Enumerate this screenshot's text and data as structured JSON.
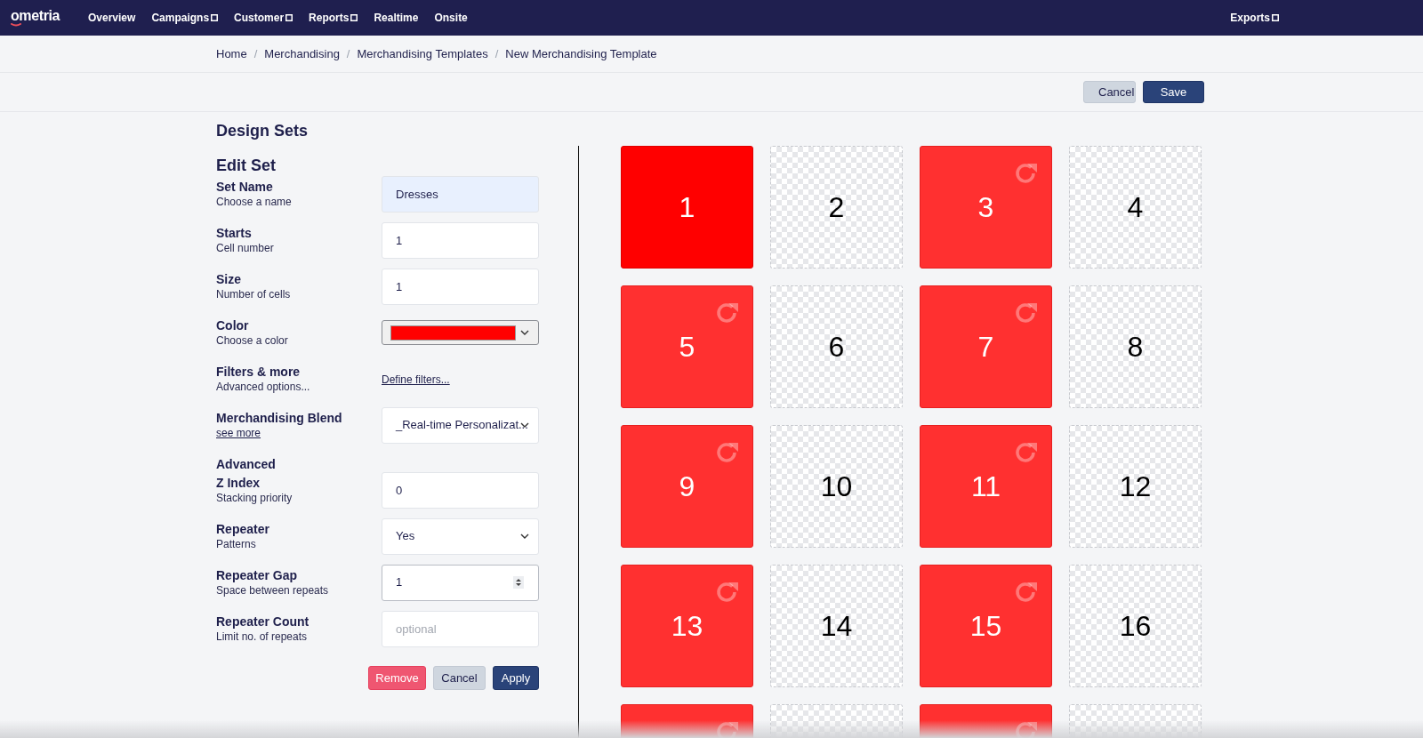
{
  "nav": {
    "logo": "ometria",
    "items": [
      {
        "label": "Overview",
        "dropdown": false
      },
      {
        "label": "Campaigns",
        "dropdown": true
      },
      {
        "label": "Customer",
        "dropdown": true
      },
      {
        "label": "Reports",
        "dropdown": true
      },
      {
        "label": "Realtime",
        "dropdown": false
      },
      {
        "label": "Onsite",
        "dropdown": false
      }
    ],
    "right_items": [
      {
        "label": "Exports",
        "dropdown": true
      }
    ]
  },
  "breadcrumbs": {
    "items": [
      "Home",
      "Merchandising",
      "Merchandising Templates",
      "New Merchandising Template"
    ],
    "separators": [
      "/",
      "/",
      "/"
    ]
  },
  "toolbar": {
    "buttons": [
      {
        "label": "Cancel",
        "kind": "secondary"
      },
      {
        "label": "Save",
        "kind": "primary"
      }
    ]
  },
  "design_sets": {
    "title": "Design Sets",
    "subtitle": "Edit Set",
    "fields": [
      {
        "kind": "text",
        "label": "Set Name",
        "hint": "Choose a name",
        "value": "Dresses",
        "focused": true
      },
      {
        "kind": "text",
        "label": "Starts",
        "hint": "Cell number",
        "value": "1",
        "focused": false
      },
      {
        "kind": "text",
        "label": "Size",
        "hint": "Number of cells",
        "value": "1",
        "focused": false
      },
      {
        "kind": "color",
        "label": "Color",
        "hint": "Choose a color",
        "color": "#ff0000"
      },
      {
        "kind": "link",
        "label": "Filters & more",
        "hint": "Advanced options...",
        "link": "Define filters..."
      },
      {
        "kind": "select",
        "label": "Merchandising Blend",
        "hint_link": "see more",
        "value": "_Real-time Personalizat..."
      },
      {
        "kind": "heading",
        "label": "Advanced"
      },
      {
        "kind": "text",
        "label": "Z Index",
        "hint": "Stacking priority",
        "value": "0",
        "focused": false
      },
      {
        "kind": "select",
        "label": "Repeater",
        "hint": "Patterns",
        "value": "Yes"
      },
      {
        "kind": "number",
        "label": "Repeater Gap",
        "hint": "Space between repeats",
        "value": "1"
      },
      {
        "kind": "text",
        "label": "Repeater Count",
        "hint": "Limit no. of repeats",
        "placeholder": "optional",
        "focused": false
      }
    ],
    "buttons": [
      {
        "label": "Remove",
        "kind": "danger"
      },
      {
        "label": "Cancel",
        "kind": "secondary"
      },
      {
        "label": "Apply",
        "kind": "primary"
      }
    ]
  },
  "grid": {
    "cells": [
      {
        "label": "1",
        "kind": "primary"
      },
      {
        "label": "2",
        "kind": "empty"
      },
      {
        "label": "3",
        "kind": "repeat"
      },
      {
        "label": "4",
        "kind": "empty"
      },
      {
        "label": "5",
        "kind": "repeat"
      },
      {
        "label": "6",
        "kind": "empty"
      },
      {
        "label": "7",
        "kind": "repeat"
      },
      {
        "label": "8",
        "kind": "empty"
      },
      {
        "label": "9",
        "kind": "repeat"
      },
      {
        "label": "10",
        "kind": "empty"
      },
      {
        "label": "11",
        "kind": "repeat"
      },
      {
        "label": "12",
        "kind": "empty"
      },
      {
        "label": "13",
        "kind": "repeat"
      },
      {
        "label": "14",
        "kind": "empty"
      },
      {
        "label": "15",
        "kind": "repeat"
      },
      {
        "label": "16",
        "kind": "empty"
      },
      {
        "kind": "repeat"
      },
      {
        "kind": "empty"
      },
      {
        "kind": "repeat"
      },
      {
        "kind": "empty"
      }
    ]
  }
}
